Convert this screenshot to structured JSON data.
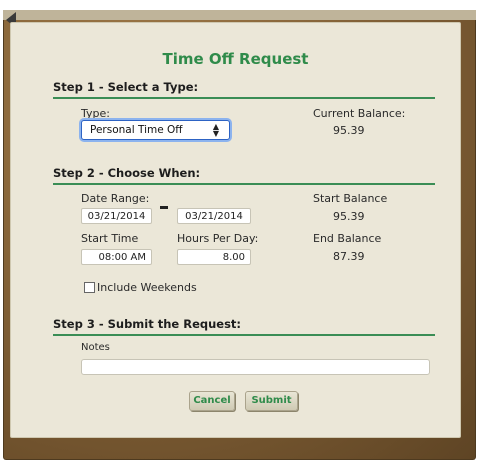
{
  "dialog": {
    "title": "Time Off Request"
  },
  "step1": {
    "heading": "Step 1 - Select a Type:",
    "type_label": "Type:",
    "type_value": "Personal Time Off",
    "current_balance_label": "Current Balance:",
    "current_balance_value": "95.39"
  },
  "step2": {
    "heading": "Step 2 - Choose When:",
    "date_range_label": "Date Range:",
    "start_date": "03/21/2014",
    "end_date": "03/21/2014",
    "start_time_label": "Start Time",
    "start_time": "08:00 AM",
    "hours_per_day_label": "Hours Per Day:",
    "hours_per_day": "8.00",
    "start_balance_label": "Start Balance",
    "start_balance_value": "95.39",
    "end_balance_label": "End Balance",
    "end_balance_value": "87.39",
    "include_weekends_label": "Include Weekends",
    "include_weekends_checked": false
  },
  "step3": {
    "heading": "Step 3 - Submit the Request:",
    "notes_label": "Notes",
    "notes_value": ""
  },
  "buttons": {
    "cancel": "Cancel",
    "submit": "Submit"
  },
  "colors": {
    "accent": "#2f8b4a",
    "frame": "#8c6a3e",
    "panel": "#ebe7d8"
  }
}
